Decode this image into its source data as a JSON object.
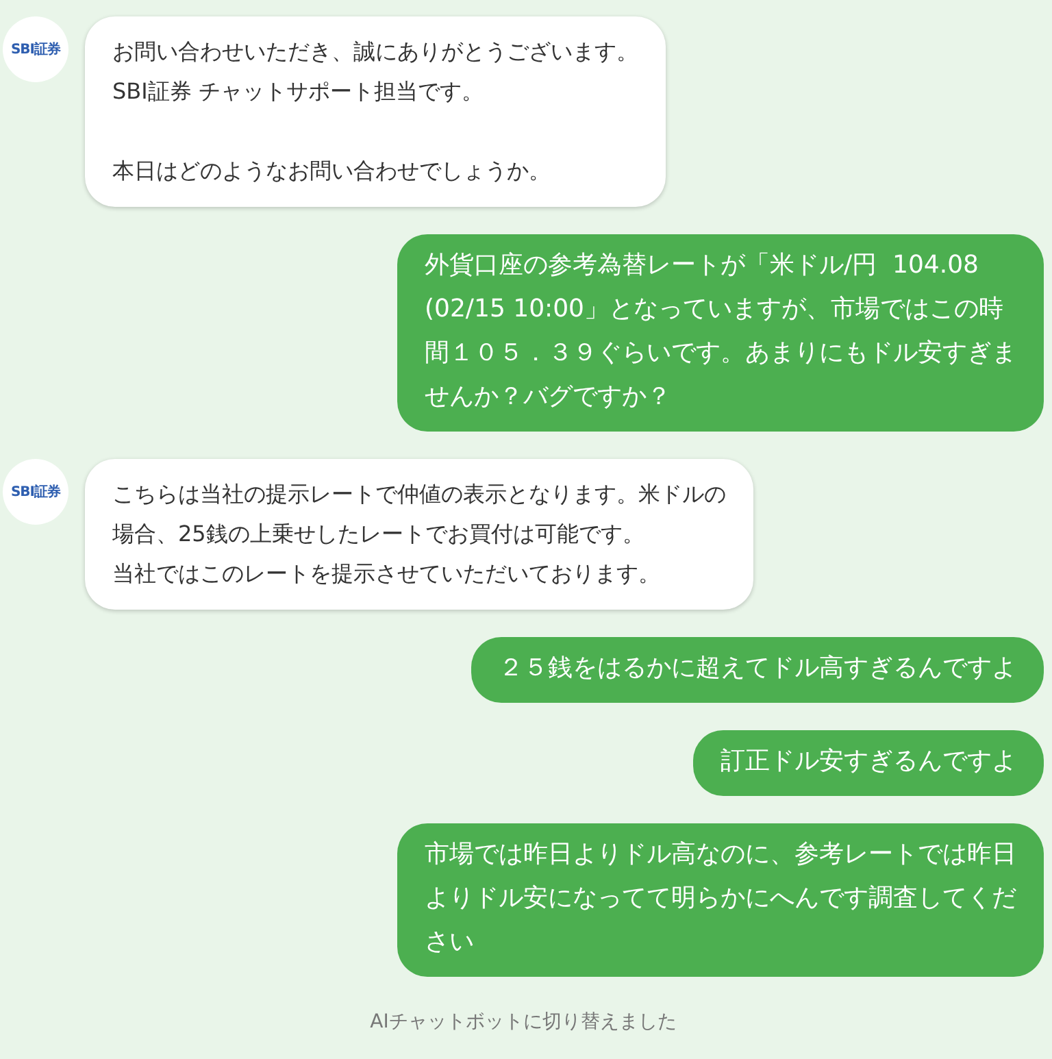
{
  "messages": [
    {
      "kind": "bot",
      "avatar": "SBI証券",
      "paragraphs": [
        [
          "お問い合わせいただき、誠にありがとうございます。",
          "SBI証券 チャットサポート担当です。"
        ],
        [
          "本日はどのようなお問い合わせでしょうか。"
        ]
      ]
    },
    {
      "kind": "user",
      "paragraphs": [
        [
          "外貨口座の参考為替レートが「米ドル/円  104.08",
          "(02/15 10:00」となっていますが、市場ではこの時",
          "間１０５．３９ぐらいです。あまりにもドル安すぎま",
          "せんか？バグですか？"
        ]
      ]
    },
    {
      "kind": "bot",
      "avatar": "SBI証券",
      "paragraphs": [
        [
          "こちらは当社の提示レートで仲値の表示となります。米ドルの",
          "場合、25銭の上乗せしたレートでお買付は可能です。",
          "当社ではこのレートを提示させていただいております。"
        ]
      ]
    },
    {
      "kind": "user",
      "paragraphs": [
        [
          "２５銭をはるかに超えてドル高すぎるんですよ"
        ]
      ]
    },
    {
      "kind": "user",
      "paragraphs": [
        [
          "訂正ドル安すぎるんですよ"
        ]
      ]
    },
    {
      "kind": "user",
      "paragraphs": [
        [
          "市場では昨日よりドル高なのに、参考レートでは昨日",
          "よりドル安になってて明らかにへんです調査してくだ",
          "さい"
        ]
      ]
    }
  ],
  "system_notice": "AIチャットボットに切り替えました"
}
